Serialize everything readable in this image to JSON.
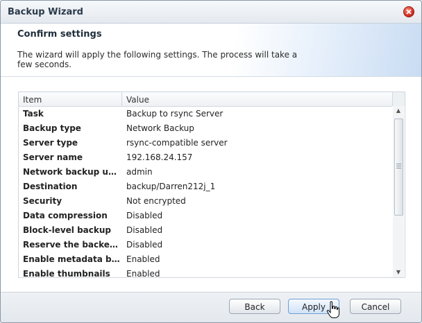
{
  "window": {
    "title": "Backup Wizard",
    "close_icon": "close-icon"
  },
  "header": {
    "title": "Confirm settings",
    "description": "The wizard will apply the following settings. The process will take a few seconds."
  },
  "table": {
    "columns": [
      "Item",
      "Value"
    ],
    "rows": [
      {
        "item": "Task",
        "value": "Backup to rsync Server"
      },
      {
        "item": "Backup type",
        "value": "Network Backup"
      },
      {
        "item": "Server type",
        "value": "rsync-compatible server"
      },
      {
        "item": "Server name",
        "value": "192.168.24.157"
      },
      {
        "item": "Network backup user",
        "value": "admin"
      },
      {
        "item": "Destination",
        "value": "backup/Darren212j_1"
      },
      {
        "item": "Security",
        "value": "Not encrypted"
      },
      {
        "item": "Data compression",
        "value": "Disabled"
      },
      {
        "item": "Block-level backup",
        "value": "Disabled"
      },
      {
        "item": "Reserve the backed...",
        "value": "Disabled"
      },
      {
        "item": "Enable metadata ba...",
        "value": "Enabled"
      },
      {
        "item": "Enable thumbnails",
        "value": "Enabled"
      }
    ]
  },
  "buttons": {
    "back": "Back",
    "apply": "Apply",
    "cancel": "Cancel"
  }
}
